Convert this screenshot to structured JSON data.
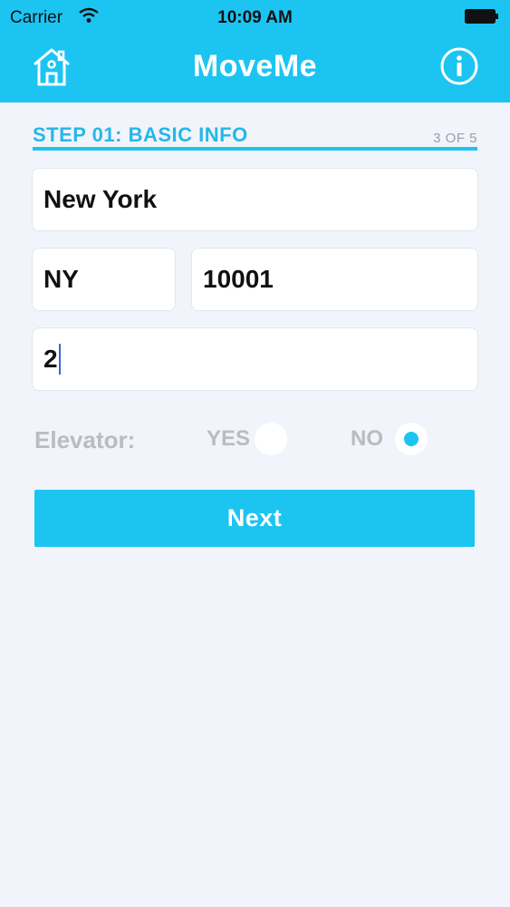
{
  "status_bar": {
    "carrier": "Carrier",
    "time": "10:09 AM"
  },
  "nav": {
    "title": "MoveMe",
    "left_icon": "home-icon",
    "right_icon": "info-icon"
  },
  "step": {
    "title": "STEP 01: BASIC INFO",
    "count": "3 OF 5"
  },
  "form": {
    "city": "New York",
    "state": "NY",
    "zip": "10001",
    "floor": "2"
  },
  "elevator": {
    "label": "Elevator:",
    "yes_label": "YES",
    "no_label": "NO",
    "selected": "NO"
  },
  "next_label": "Next",
  "colors": {
    "accent": "#1cc4f2",
    "background": "#f1f4fb",
    "muted_text": "#b9bcc2"
  }
}
